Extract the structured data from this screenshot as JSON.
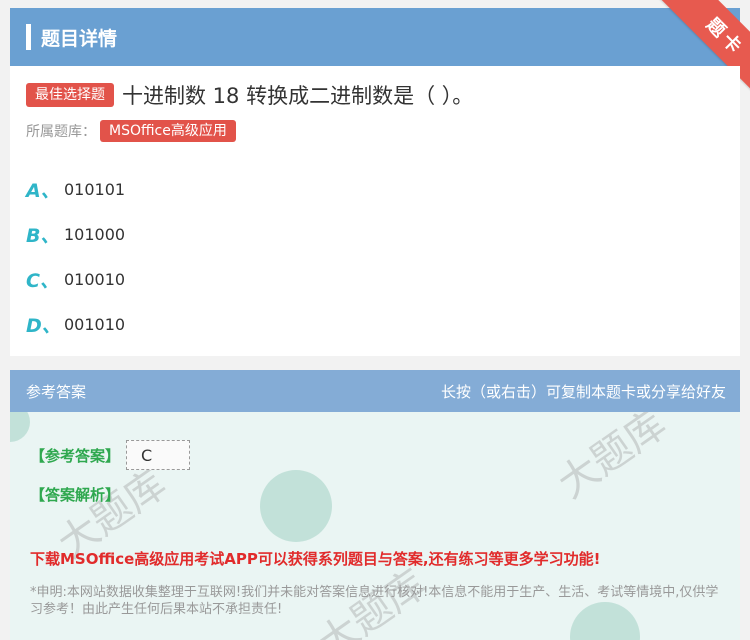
{
  "header": {
    "title": "题目详情"
  },
  "corner": {
    "label": "题卡"
  },
  "question": {
    "tag": "最佳选择题",
    "text": "十进制数 18 转换成二进制数是（   ）。",
    "bank_label": "所属题库：",
    "bank_name": "MSOffice高级应用"
  },
  "options": [
    {
      "letter": "A、",
      "text": "010101"
    },
    {
      "letter": "B、",
      "text": "101000"
    },
    {
      "letter": "C、",
      "text": "010010"
    },
    {
      "letter": "D、",
      "text": "001010"
    }
  ],
  "answer_section": {
    "title": "参考答案",
    "hint": "长按（或右击）可复制本题卡或分享给好友",
    "ref_label": "【参考答案】",
    "ref_value": "C",
    "analysis_label": "【答案解析】",
    "promo": "下载MSOffice高级应用考试APP可以获得系列题目与答案,还有练习等更多学习功能!",
    "disclaimer": "*申明:本网站数据收集整理于互联网!我们并未能对答案信息进行核对!本信息不能用于生产、生活、考试等情境中,仅供学习参考！由此产生任何后果本站不承担责任!"
  },
  "colors": {
    "header": "#6aa0d2",
    "accent_red": "#e2534a",
    "option_letter": "#2fb5c8",
    "answer_green": "#2fa84f"
  }
}
